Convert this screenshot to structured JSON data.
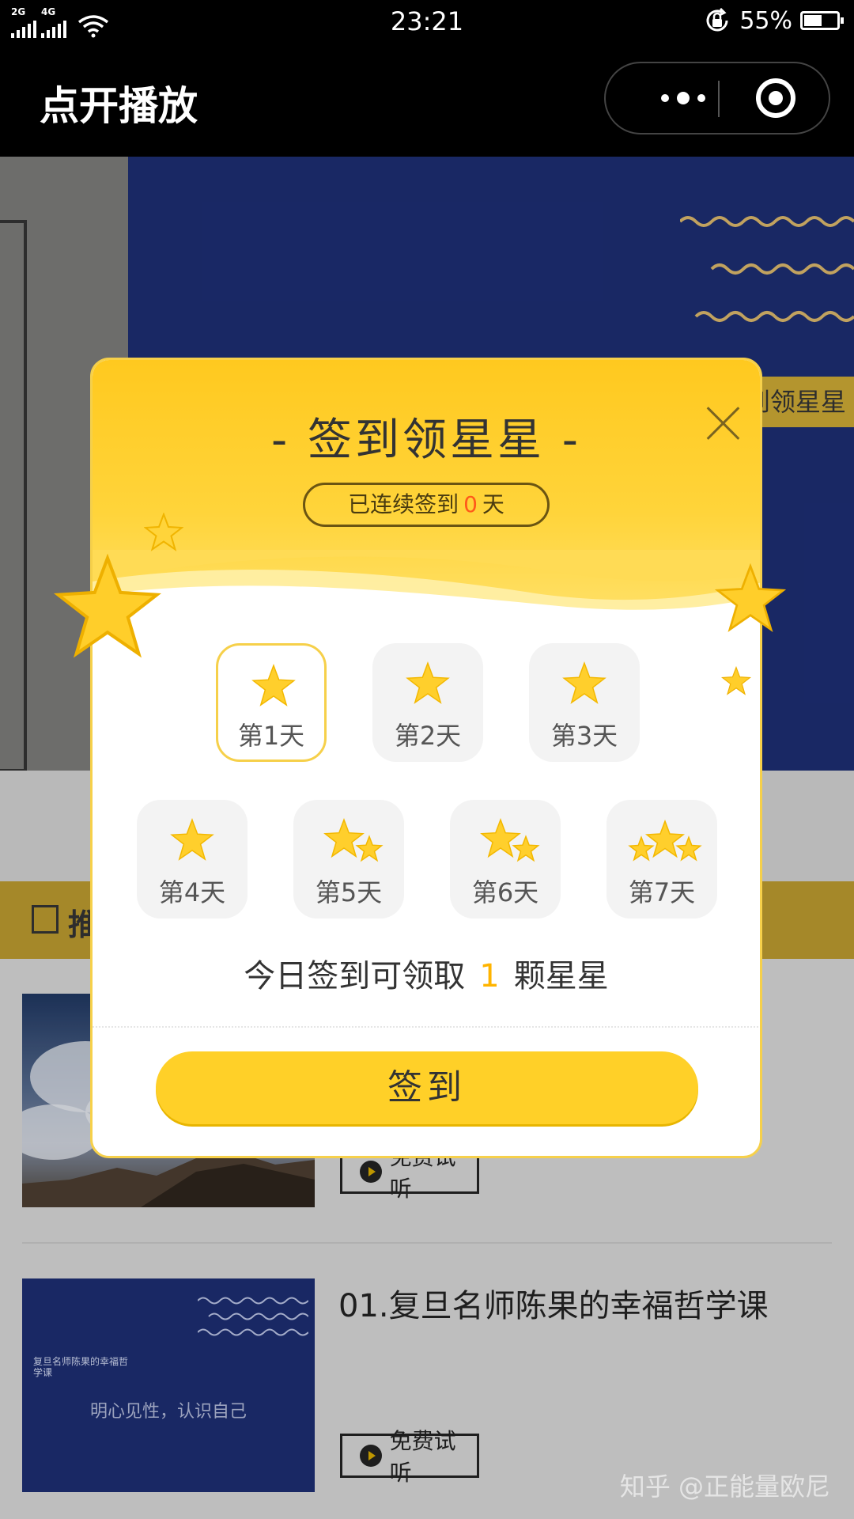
{
  "status_bar": {
    "net_left": "2G",
    "net_right": "4G",
    "time": "23:21",
    "battery": "55%",
    "battery_level": 0.55
  },
  "nav": {
    "title": "点开播放"
  },
  "background": {
    "banner_tag": "签到领星星",
    "section_title": "推",
    "trial_label": "免费试听",
    "course_title": "01.复旦名师陈果的幸福哲学课",
    "thumb_caption": "复旦名师陈果的幸福哲学课",
    "thumb_slogan": "明心见性，认识自己",
    "watermark": "知乎 @正能量欧尼"
  },
  "modal": {
    "title": "- 签到领星星 -",
    "streak_prefix": "已连续签到",
    "streak_days": "0",
    "streak_suffix": "天",
    "days": [
      {
        "label": "第1天",
        "stars": 1,
        "active": true
      },
      {
        "label": "第2天",
        "stars": 1,
        "active": false
      },
      {
        "label": "第3天",
        "stars": 1,
        "active": false
      },
      {
        "label": "第4天",
        "stars": 1,
        "active": false
      },
      {
        "label": "第5天",
        "stars": 2,
        "active": false
      },
      {
        "label": "第6天",
        "stars": 2,
        "active": false
      },
      {
        "label": "第7天",
        "stars": 3,
        "active": false
      }
    ],
    "reward_prefix": "今日签到可领取",
    "reward_count": "1",
    "reward_suffix": "颗星星",
    "button": "签到"
  },
  "colors": {
    "accent": "#FFD028",
    "highlight": "#FFB400",
    "streak_number": "#FF5A1A",
    "banner_blue": "#1C2D70"
  }
}
